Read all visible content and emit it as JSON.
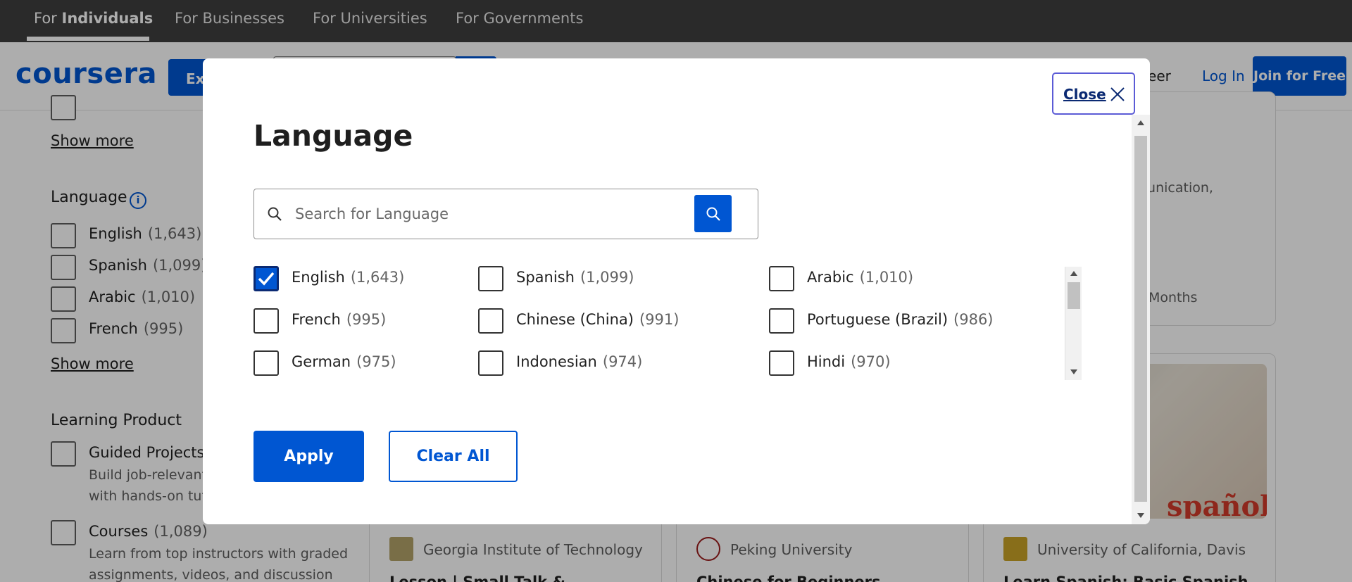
{
  "topbar": {
    "tabs": [
      {
        "prefix": "For ",
        "strong": "Individuals"
      },
      {
        "label": "For Businesses"
      },
      {
        "label": "For Universities"
      },
      {
        "label": "For Governments"
      }
    ]
  },
  "header": {
    "logo": "coursera",
    "explore_label": "Ex",
    "career_label": "areer",
    "login_label": "Log In",
    "join_label": "Join for Free"
  },
  "sidebar": {
    "show_more_1": "Show more",
    "language_heading": "Language",
    "info_icon": "i",
    "languages": [
      {
        "name": "English",
        "count": "(1,643)"
      },
      {
        "name": "Spanish",
        "count": "(1,099)"
      },
      {
        "name": "Arabic",
        "count": "(1,010)"
      },
      {
        "name": "French",
        "count": "(995)"
      }
    ],
    "show_more_2": "Show more",
    "product_heading": "Learning Product",
    "products": [
      {
        "name": "Guided Projects",
        "count": "",
        "desc": "Build job-relevant\nwith hands-on tuto"
      },
      {
        "name": "Courses",
        "count": "(1,089)",
        "desc": "Learn from top instructors with graded\nassignments, videos, and discussion"
      }
    ]
  },
  "cards": {
    "snippet_1": "nunication,",
    "snippet_2": "Months",
    "partners": [
      {
        "name": "Georgia Institute of Technology",
        "logo_color": "#b3a369",
        "title": "Lesson | Small Talk &"
      },
      {
        "name": "Peking University",
        "logo_color": "#9b1c1c",
        "title": "Chinese for Beginners"
      },
      {
        "name": "University of California, Davis",
        "logo_color": "#c9a227",
        "title": "Learn Spanish: Basic Spanish"
      }
    ],
    "image_text": "spañol"
  },
  "modal": {
    "close_label": "Close",
    "title": "Language",
    "search_placeholder": "Search for Language",
    "languages": [
      {
        "name": "English",
        "count": "(1,643)",
        "checked": true
      },
      {
        "name": "Spanish",
        "count": "(1,099)",
        "checked": false
      },
      {
        "name": "Arabic",
        "count": "(1,010)",
        "checked": false
      },
      {
        "name": "French",
        "count": "(995)",
        "checked": false
      },
      {
        "name": "Chinese (China)",
        "count": "(991)",
        "checked": false
      },
      {
        "name": "Portuguese (Brazil)",
        "count": "(986)",
        "checked": false
      },
      {
        "name": "German",
        "count": "(975)",
        "checked": false
      },
      {
        "name": "Indonesian",
        "count": "(974)",
        "checked": false
      },
      {
        "name": "Hindi",
        "count": "(970)",
        "checked": false
      }
    ],
    "apply_label": "Apply",
    "clear_label": "Clear All"
  },
  "colors": {
    "brand_blue": "#0056d2",
    "topbar_bg": "#3f3f3f",
    "focus_outline": "#5b5bd6"
  }
}
